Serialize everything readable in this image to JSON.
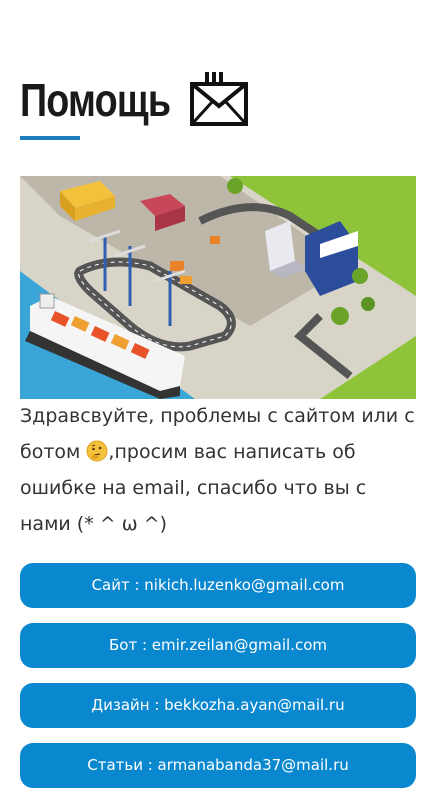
{
  "page": {
    "title": "Помощь",
    "message_part1": "Здравсвуйте, проблемы с сайтом или с ботом ",
    "message_part2": ",просим вас написать об ошибке на email, спасибо что вы с нами (* ^ ω ^)",
    "emoji_icon": "thinking-face-icon",
    "title_icon": "envelope-icon",
    "accent_color": "#1e7fc0",
    "button_color": "#0a88cf"
  },
  "contacts": [
    {
      "label": "Сайт : nikich.luzenko@gmail.com"
    },
    {
      "label": "Бот : emir.zeilan@gmail.com"
    },
    {
      "label": "Дизайн : bekkozha.ayan@mail.ru"
    },
    {
      "label": "Статьи : armanabanda37@mail.ru"
    }
  ]
}
